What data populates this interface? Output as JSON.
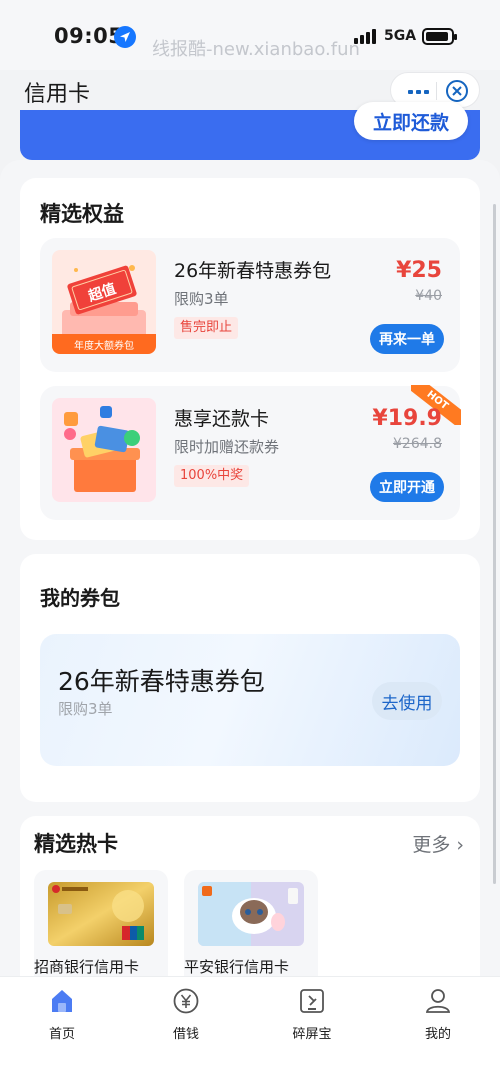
{
  "status_bar": {
    "time": "09:05",
    "watermark": "线报酷-new.xianbao.fun",
    "network": "5GA"
  },
  "nav": {
    "title": "信用卡"
  },
  "banner": {
    "repay_button": "立即还款"
  },
  "benefits": {
    "title": "精选权益",
    "items": [
      {
        "name": "26年新春特惠券包",
        "desc": "限购3单",
        "tag": "售完即止",
        "price": "¥25",
        "old_price": "¥40",
        "button": "再来一单",
        "thumb_badge": "超值",
        "thumb_caption": "年度大额券包"
      },
      {
        "name": "惠享还款卡",
        "desc": "限时加赠还款券",
        "tag": "100%中奖",
        "price": "¥19.9",
        "old_price": "¥264.8",
        "button": "立即开通",
        "ribbon": "HOT"
      }
    ]
  },
  "coupons": {
    "title": "我的券包",
    "item": {
      "name": "26年新春特惠券包",
      "desc": "限购3单",
      "button": "去使用"
    }
  },
  "hot_cards": {
    "title": "精选热卡",
    "more": "更多",
    "items": [
      {
        "name": "招商银行信用卡"
      },
      {
        "name": "平安银行信用卡"
      }
    ]
  },
  "tabs": [
    {
      "label": "首页",
      "icon": "home-icon",
      "active": true
    },
    {
      "label": "借钱",
      "icon": "yuan-icon",
      "active": false
    },
    {
      "label": "碎屏宝",
      "icon": "phone-shield-icon",
      "active": false
    },
    {
      "label": "我的",
      "icon": "user-icon",
      "active": false
    }
  ],
  "colors": {
    "accent": "#1f7ae8",
    "price_red": "#e8453c",
    "banner_blue": "#3a6df0",
    "hot_orange": "#ff7a21"
  }
}
